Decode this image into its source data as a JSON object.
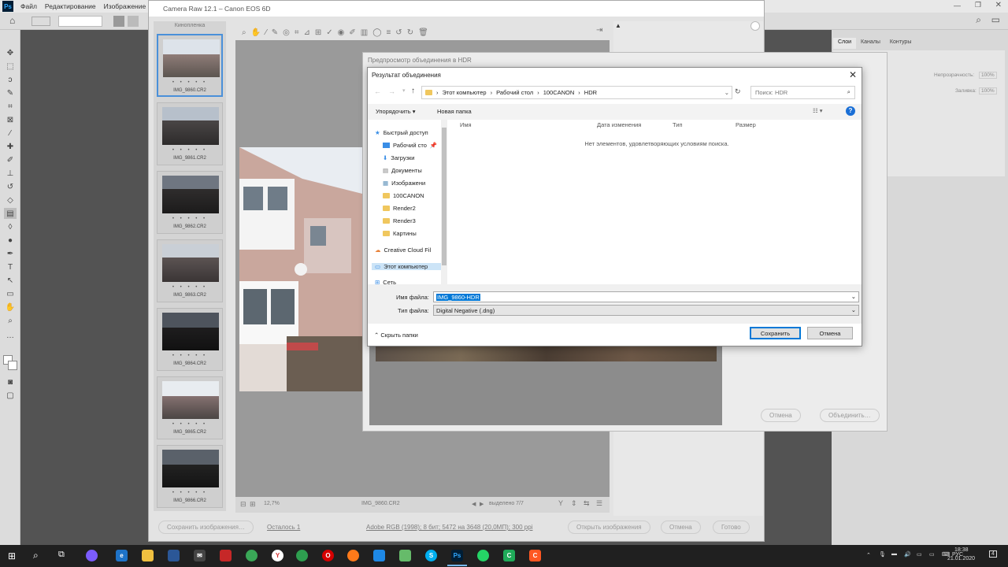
{
  "photoshop": {
    "menu": [
      "Файл",
      "Редактирование",
      "Изображение",
      "Сл"
    ],
    "panel_tabs": [
      "Слои",
      "Каналы",
      "Контуры"
    ],
    "panel_labels": {
      "opacity": "Непрозрачность:",
      "opacity_val": "100%",
      "fill": "Заливка:",
      "fill_val": "100%"
    }
  },
  "camera_raw": {
    "title": "Camera Raw 12.1 – Canon EOS 6D",
    "filmstrip_title": "Кинопленка",
    "thumbnails": [
      "IMG_9860.CR2",
      "IMG_9861.CR2",
      "IMG_9862.CR2",
      "IMG_9863.CR2",
      "IMG_9864.CR2",
      "IMG_9865.CR2",
      "IMG_9866.CR2"
    ],
    "stars": "• • • • •",
    "zoom": "12,7%",
    "current_file": "IMG_9860.CR2",
    "selected": "выделено 7/7",
    "save_images": "Сохранить изображения…",
    "remaining": "Осталось 1",
    "info_link": "Adobe RGB (1998); 8 бит; 5472 на 3648 (20,0МП); 300 ppi",
    "open_images": "Открыть изображения",
    "cancel": "Отмена",
    "done": "Готово"
  },
  "hdr_dialog": {
    "title": "Предпросмотр объединения в HDR",
    "cancel": "Отмена",
    "merge": "Объединить…"
  },
  "save_dialog": {
    "title": "Результат объединения",
    "breadcrumb": [
      "Этот компьютер",
      "Рабочий стол",
      "100CANON",
      "HDR"
    ],
    "search_placeholder": "Поиск: HDR",
    "organize": "Упорядочить",
    "new_folder": "Новая папка",
    "nav": [
      {
        "label": "Быстрый доступ",
        "icon": "star-icon"
      },
      {
        "label": "Рабочий сто",
        "icon": "desktop-icon"
      },
      {
        "label": "Загрузки",
        "icon": "download-icon"
      },
      {
        "label": "Документы",
        "icon": "document-icon"
      },
      {
        "label": "Изображени",
        "icon": "image-icon"
      },
      {
        "label": "100CANON",
        "icon": "folder-icon"
      },
      {
        "label": "Render2",
        "icon": "folder-icon"
      },
      {
        "label": "Render3",
        "icon": "folder-icon"
      },
      {
        "label": "Картины",
        "icon": "folder-icon"
      },
      {
        "label": "Creative Cloud Fil",
        "icon": "cloud-icon"
      },
      {
        "label": "Этот компьютер",
        "icon": "computer-icon"
      },
      {
        "label": "Сеть",
        "icon": "network-icon"
      }
    ],
    "columns": [
      "Имя",
      "Дата изменения",
      "Тип",
      "Размер"
    ],
    "empty_message": "Нет элементов, удовлетворяющих условиям поиска.",
    "filename_label": "Имя файла:",
    "filename_value": "IMG_9860-HDR",
    "filetype_label": "Тип файла:",
    "filetype_value": "Digital Negative (.dng)",
    "hide_folders": "Скрыть папки",
    "save": "Сохранить",
    "cancel": "Отмена"
  },
  "taskbar": {
    "lang": "РУС",
    "time": "18:38",
    "date": "21.01.2020",
    "notifications": "4"
  }
}
